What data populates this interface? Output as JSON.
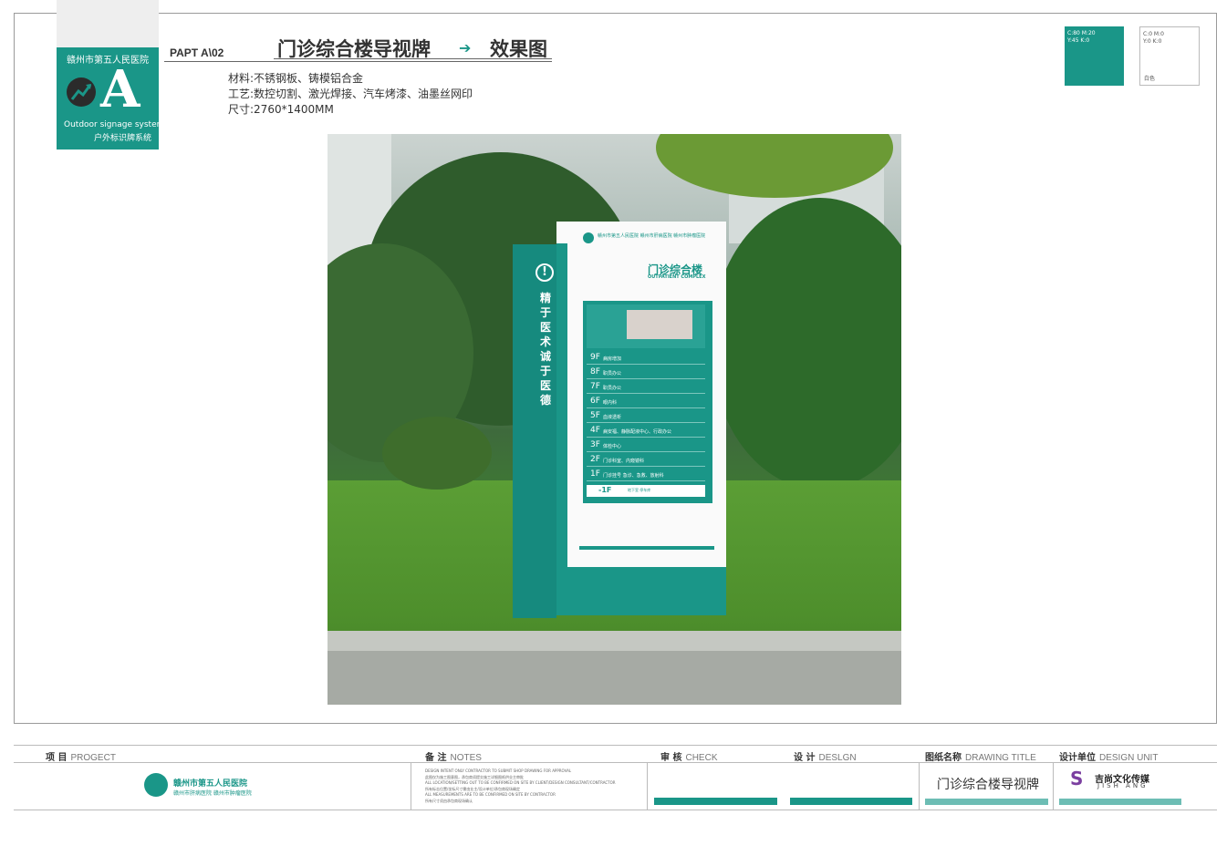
{
  "logo": {
    "hospital": "赣州市第五人民医院",
    "letter": "A",
    "system_en": "Outdoor signage system",
    "system_cn": "户外标识牌系统"
  },
  "header": {
    "code": "PAPT  A\\02",
    "title": "门诊综合楼导视牌",
    "arrow": "➔",
    "subtitle": "效果图",
    "specs": [
      "材料:不锈钢板、铸模铝合金",
      "工艺:数控切割、激光焊接、汽车烤漆、油墨丝网印",
      "尺寸:2760*1400MM"
    ]
  },
  "swatches": {
    "teal_line1": "C:80 M:20",
    "teal_line2": "Y:45 K:0",
    "white_line1": "C:0 M:0",
    "white_line2": "Y:0 K:0",
    "white_label": "白色",
    "teal_color": "#1a9688"
  },
  "sign": {
    "excl": "!",
    "motto": "精于医术　诚于医德",
    "hospital": "赣州市第五人民医院  赣州市肝病医院 赣州市肿瘤医院",
    "title": "门诊综合楼",
    "title_en": "OUTPATIENT COMPLEX",
    "floors": [
      {
        "num": "9F",
        "desc": "病房增加"
      },
      {
        "num": "8F",
        "desc": "职员办公"
      },
      {
        "num": "7F",
        "desc": "职员办公"
      },
      {
        "num": "6F",
        "desc": "眼内科"
      },
      {
        "num": "5F",
        "desc": "血液透析"
      },
      {
        "num": "4F",
        "desc": "病安福、静脉配液中心、行政办公"
      },
      {
        "num": "3F",
        "desc": "体检中心"
      },
      {
        "num": "2F",
        "desc": "门诊科室、内窥镜科"
      },
      {
        "num": "1F",
        "desc": "门诊挂号  急诊、急救、放射科"
      }
    ],
    "basement": {
      "num": "-1F",
      "desc": "地下室   停车库"
    }
  },
  "footer": {
    "project_cn": "项 目",
    "project_en": "PROGECT",
    "notes_cn": "备 注",
    "notes_en": "NOTES",
    "check_cn": "审 核",
    "check_en": "CHECK",
    "design_cn": "设 计",
    "design_en": "DESLGN",
    "drawing_cn": "图纸名称",
    "drawing_en": "DRAWING TITLE",
    "unit_cn": "设计单位",
    "unit_en": "DESIGN UNIT",
    "hospital_line1": "赣州市第五人民医院",
    "hospital_line2": "赣州市肝病医院  赣州市肿瘤医院",
    "notes_lines": [
      "DESIGN INTENT ONLY CONTRACTOR TO SUBMIT SHOP DRAWING FOR APPROVAL",
      "此图仅为施工图意图，承包商须提交施工详细图纸供业主审批",
      "ALL LOCATION/SETTING OUT TO BE CONFIRMED ON SITE BY CLIENT/DESIGN CONSULTANT/CONTRACTOR",
      "所有标志位置/坐标尺寸需由业主/设计单位/承包商现场确定",
      "ALL MEASUREMENTS ARE TO BE CONFIRMED ON SITE BY CONTRACTOR",
      "所有尺寸须由承包商现场确认"
    ],
    "drawing_title": "门诊综合楼导视牌",
    "unit_logo": "S",
    "unit_name_cn": "吉尚文化传媒",
    "unit_name_en": "JISH ANG"
  }
}
